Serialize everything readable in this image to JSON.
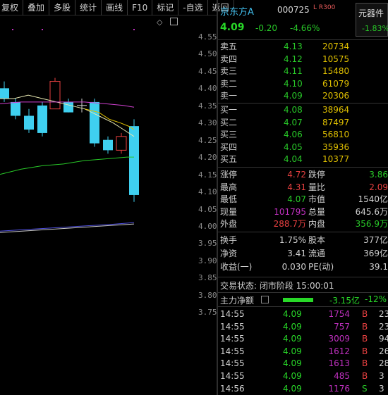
{
  "toolbar": [
    "复权",
    "叠加",
    "多股",
    "统计",
    "画线",
    "F10",
    "标记",
    "-自选",
    "返回"
  ],
  "chart": {
    "price_ticks": [
      "4.55",
      "4.50",
      "4.45",
      "4.40",
      "4.35",
      "4.30",
      "4.25",
      "4.20",
      "4.15",
      "4.10",
      "4.05",
      "4.00",
      "3.95",
      "3.90",
      "3.85",
      "3.80",
      "3.75"
    ],
    "colors": {
      "up": "#e84040",
      "down": "#3fd0f0",
      "ma5": "#e6e6b0",
      "ma10": "#d040d0",
      "ma20": "#e0c000",
      "ma60": "#28c828",
      "ma120": "#5050e0"
    }
  },
  "header": {
    "name": "京东方A",
    "code": "000725",
    "lr_badge": "L R300",
    "price": "4.09",
    "change": "-0.20",
    "change_pct": "-4.66%",
    "sector": {
      "name": "元器件",
      "change_pct": "-1.83%"
    }
  },
  "sell": [
    {
      "label": "卖五",
      "price": "4.13",
      "vol": "20734"
    },
    {
      "label": "卖四",
      "price": "4.12",
      "vol": "10575"
    },
    {
      "label": "卖三",
      "price": "4.11",
      "vol": "15480"
    },
    {
      "label": "卖二",
      "price": "4.10",
      "vol": "61079"
    },
    {
      "label": "卖一",
      "price": "4.09",
      "vol": "20306"
    }
  ],
  "buy": [
    {
      "label": "买一",
      "price": "4.08",
      "vol": "38964"
    },
    {
      "label": "买二",
      "price": "4.07",
      "vol": "87497"
    },
    {
      "label": "买三",
      "price": "4.06",
      "vol": "56810"
    },
    {
      "label": "买四",
      "price": "4.05",
      "vol": "35936"
    },
    {
      "label": "买五",
      "price": "4.04",
      "vol": "10377"
    }
  ],
  "stats": [
    {
      "k1": "涨停",
      "v1": "4.72",
      "c1": "#e84040",
      "k2": "跌停",
      "v2": "3.86",
      "c2": "#28c828"
    },
    {
      "k1": "最高",
      "v1": "4.31",
      "c1": "#e84040",
      "k2": "量比",
      "v2": "2.09",
      "c2": "#e84040"
    },
    {
      "k1": "最低",
      "v1": "4.07",
      "c1": "#28c828",
      "k2": "市值",
      "v2": "1540亿",
      "c2": "#cfcfcf"
    },
    {
      "k1": "现量",
      "v1": "101795",
      "c1": "#c030c0",
      "k2": "总量",
      "v2": "645.6万",
      "c2": "#cfcfcf"
    },
    {
      "k1": "外盘",
      "v1": "288.7万",
      "c1": "#e84040",
      "k2": "内盘",
      "v2": "356.9万",
      "c2": "#28c828"
    }
  ],
  "stats2": [
    {
      "k1": "换手",
      "v1": "1.75%",
      "k2": "股本",
      "v2": "377亿"
    },
    {
      "k1": "净资",
      "v1": "3.41",
      "k2": "流通",
      "v2": "369亿"
    },
    {
      "k1": "收益(一)",
      "v1": "0.030",
      "k2": "PE(动)",
      "v2": "39.1"
    }
  ],
  "status": "交易状态: 闭市阶段 15:00:01",
  "flow": {
    "label": "主力净额",
    "value": "-3.15亿",
    "pct": "-12%"
  },
  "ticks": [
    {
      "time": "14:55",
      "price": "4.09",
      "vol": "1754",
      "bs": "B",
      "bs_color": "#e84040",
      "n": "23"
    },
    {
      "time": "14:55",
      "price": "4.09",
      "vol": "757",
      "bs": "B",
      "bs_color": "#e84040",
      "n": "23"
    },
    {
      "time": "14:55",
      "price": "4.09",
      "vol": "3009",
      "bs": "B",
      "bs_color": "#e84040",
      "n": "94"
    },
    {
      "time": "14:55",
      "price": "4.09",
      "vol": "1612",
      "bs": "B",
      "bs_color": "#e84040",
      "n": "26"
    },
    {
      "time": "14:55",
      "price": "4.09",
      "vol": "1613",
      "bs": "B",
      "bs_color": "#e84040",
      "n": "28"
    },
    {
      "time": "14:55",
      "price": "4.09",
      "vol": "485",
      "bs": "B",
      "bs_color": "#e84040",
      "n": "3"
    },
    {
      "time": "14:56",
      "price": "4.09",
      "vol": "1176",
      "bs": "S",
      "bs_color": "#28c828",
      "n": "3"
    }
  ]
}
